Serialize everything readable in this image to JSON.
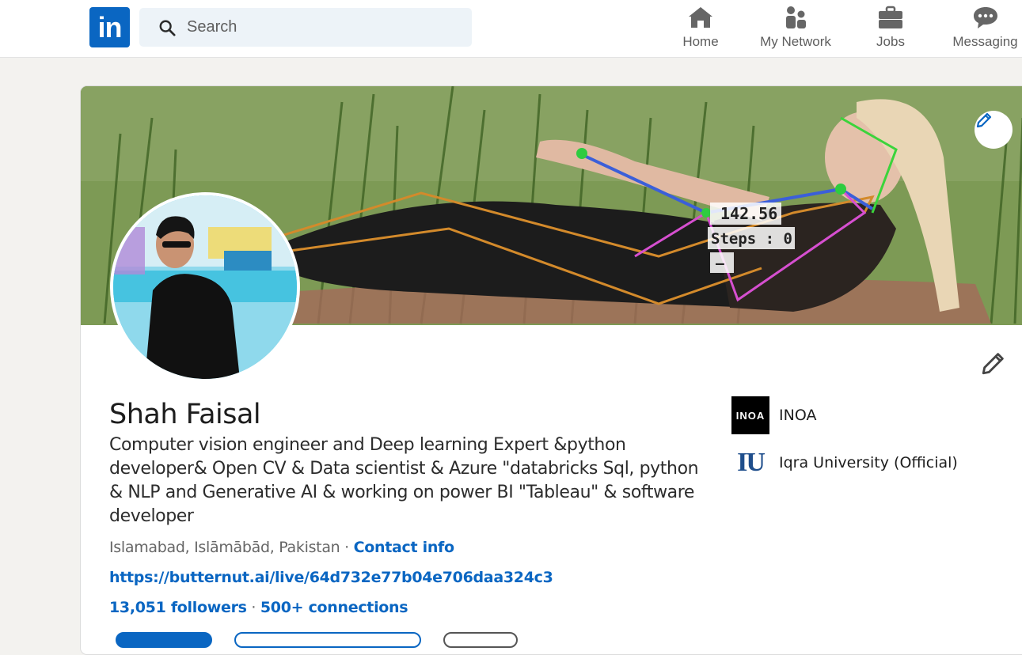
{
  "nav": {
    "logo_text": "in",
    "search_placeholder": "Search",
    "items": [
      {
        "label": "Home",
        "icon": "home-icon"
      },
      {
        "label": "My Network",
        "icon": "network-icon"
      },
      {
        "label": "Jobs",
        "icon": "briefcase-icon"
      },
      {
        "label": "Messaging",
        "icon": "messaging-icon"
      }
    ]
  },
  "banner": {
    "overlay_angle": "142.56",
    "overlay_steps": "Steps : 0",
    "overlay_dash": "–"
  },
  "profile": {
    "name": "Shah Faisal",
    "headline": "Computer vision engineer and Deep learning Expert &python developer& Open CV & Data scientist & Azure \"databricks Sql, python & NLP and Generative AI & working on power BI \"Tableau\" & software developer",
    "location": "Islamabad, Islāmābād, Pakistan",
    "separator": " · ",
    "contact_info_label": "Contact info",
    "website": "https://butternut.ai/live/64d732e77b04e706daa324c3",
    "followers": "13,051 followers",
    "stats_separator": " · ",
    "connections": "500+ connections"
  },
  "organizations": [
    {
      "name": "INOA",
      "logo_text": "INOA"
    },
    {
      "name": "Iqra University (Official)",
      "logo_text": "IU"
    }
  ],
  "colors": {
    "brand": "#0a66c2",
    "nav_text": "#5e5e5e",
    "search_bg": "#edf3f8"
  }
}
